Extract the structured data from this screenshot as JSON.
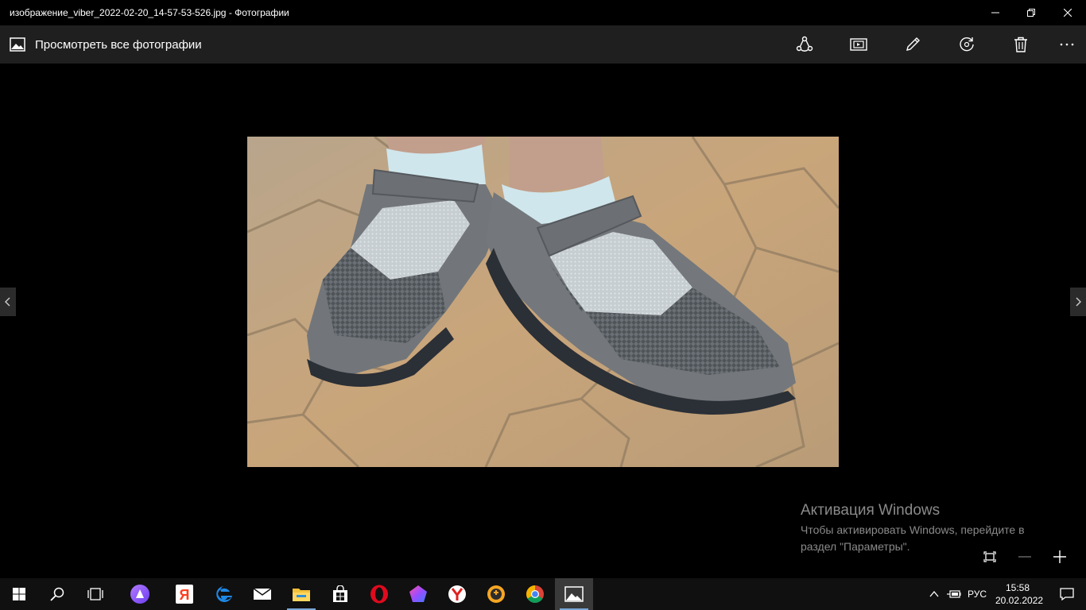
{
  "window": {
    "title": "изображение_viber_2022-02-20_14-57-53-526.jpg - Фотографии",
    "minimize_icon": "minimize-icon",
    "restore_icon": "restore-icon",
    "close_icon": "close-icon"
  },
  "appbar": {
    "back_label": "Просмотреть все фотографии",
    "tools": [
      "share-icon",
      "slideshow-icon",
      "edit-icon",
      "rotate-icon",
      "delete-icon",
      "more-icon"
    ]
  },
  "viewer": {
    "image_subject": "photo of gray mesh shoes with velcro straps on a tiled floor",
    "prev_icon": "chevron-left-icon",
    "next_icon": "chevron-right-icon"
  },
  "watermark": {
    "title": "Активация Windows",
    "line1": "Чтобы активировать Windows, перейдите в",
    "line2": "раздел \"Параметры\"."
  },
  "zoom": {
    "fit_icon": "fit-screen-icon",
    "zoom_out_icon": "zoom-out-icon",
    "zoom_in_icon": "zoom-in-icon"
  },
  "taskbar": {
    "items": [
      "start-icon",
      "search-icon",
      "task-view-icon",
      "alice-icon",
      "yandex-icon",
      "edge-icon",
      "mail-icon",
      "explorer-icon",
      "store-icon",
      "opera-icon",
      "polygon-app-icon",
      "yandex-browser-icon",
      "browser-shield-icon",
      "chrome-icon",
      "photos-icon"
    ],
    "tray": {
      "language": "РУС",
      "time": "15:58",
      "date": "20.02.2022"
    }
  },
  "colors": {
    "titlebar": "#000000",
    "appbar": "#1f1f1f",
    "taskbar": "#101010",
    "watermark": "#8a8a8a"
  }
}
